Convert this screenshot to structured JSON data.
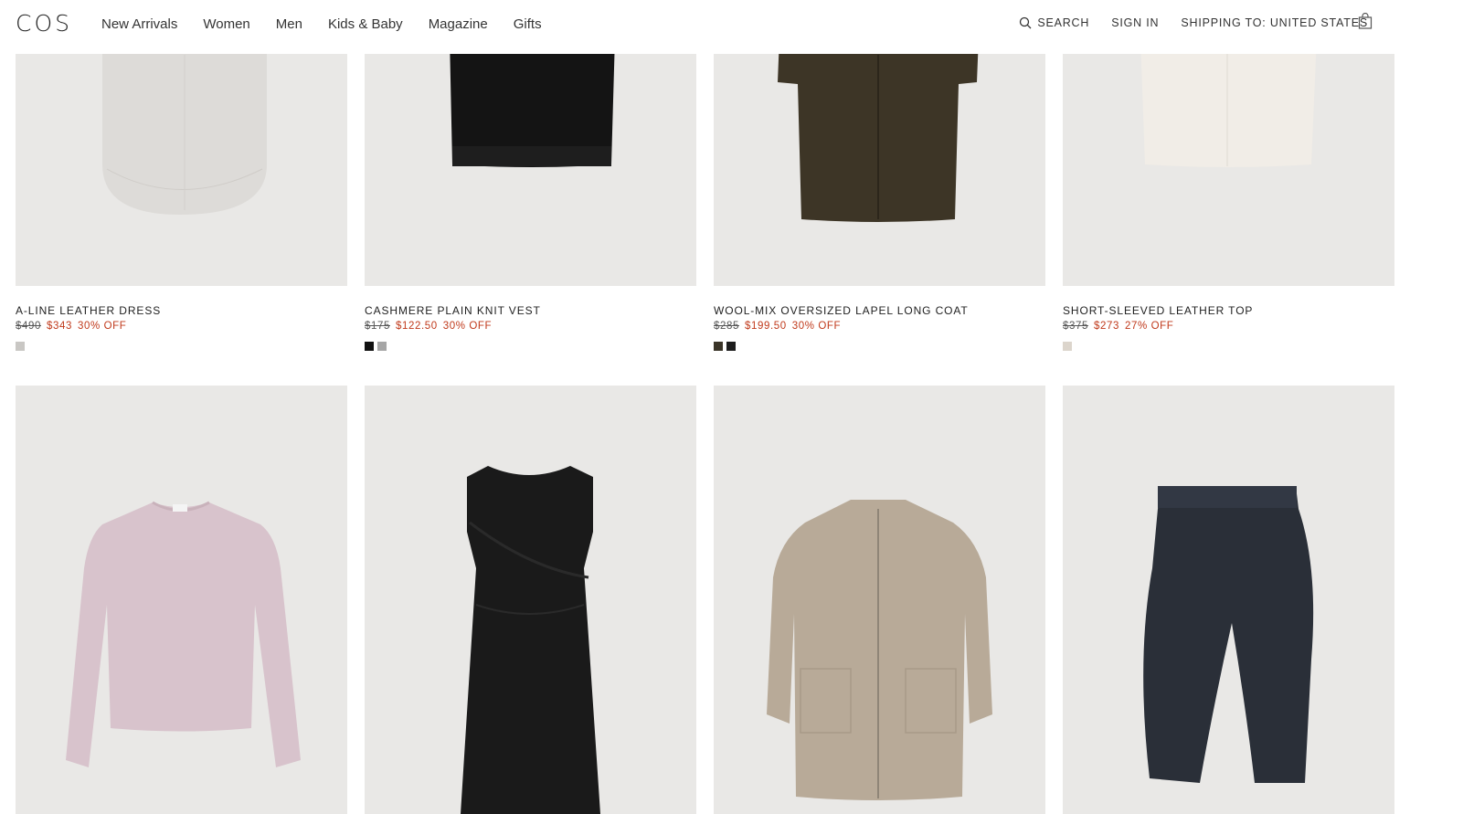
{
  "header": {
    "logo": "COS",
    "nav": [
      "New Arrivals",
      "Women",
      "Men",
      "Kids & Baby",
      "Magazine",
      "Gifts"
    ],
    "search_label": "SEARCH",
    "sign_in_label": "SIGN IN",
    "shipping_label": "SHIPPING TO: UNITED STATES",
    "icons": {
      "search": "search-icon",
      "bag": "shopping-bag-icon"
    }
  },
  "products_row1": [
    {
      "name": "A-LINE LEATHER DRESS",
      "old_price": "$490",
      "new_price": "$343",
      "discount": "30% OFF",
      "swatches": [
        "#c9c7c4"
      ]
    },
    {
      "name": "CASHMERE PLAIN KNIT VEST",
      "old_price": "$175",
      "new_price": "$122.50",
      "discount": "30% OFF",
      "swatches": [
        "#111111",
        "#a6a6a6"
      ]
    },
    {
      "name": "WOOL-MIX OVERSIZED LAPEL LONG COAT",
      "old_price": "$285",
      "new_price": "$199.50",
      "discount": "30% OFF",
      "swatches": [
        "#3a3428",
        "#1d1d1d"
      ]
    },
    {
      "name": "SHORT-SLEEVED LEATHER TOP",
      "old_price": "$375",
      "new_price": "$273",
      "discount": "27% OFF",
      "swatches": [
        "#dcd5cc"
      ]
    }
  ],
  "products_row2": [
    {
      "product": "pink crewneck sweater"
    },
    {
      "product": "black sleeveless dress"
    },
    {
      "product": "beige zip-up knit cardigan"
    },
    {
      "product": "navy wide-leg trousers"
    }
  ],
  "colors": {
    "sale_red": "#c0391b",
    "image_bg": "#e9e8e6"
  }
}
